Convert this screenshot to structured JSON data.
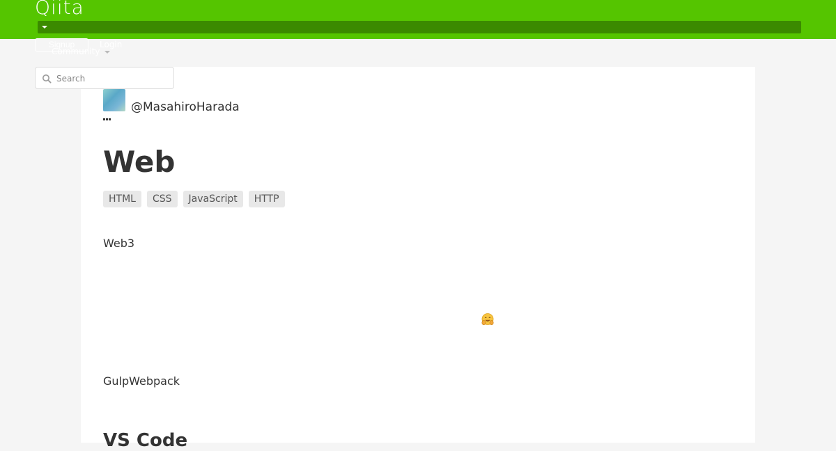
{
  "header": {
    "logo": "Qiita",
    "signup_label": "Signup",
    "login_label": "Login",
    "community_label": "Community",
    "brand_color": "#55c500"
  },
  "search": {
    "placeholder": "Search"
  },
  "article": {
    "author": "@MasahiroHarada",
    "title": "Web",
    "tags": [
      "HTML",
      "CSS",
      "JavaScript",
      "HTTP"
    ],
    "paragraphs": [
      "Web3",
      "GulpWebpack"
    ],
    "emoji": "hugging-face-emoji",
    "next_heading": "VS Code"
  }
}
